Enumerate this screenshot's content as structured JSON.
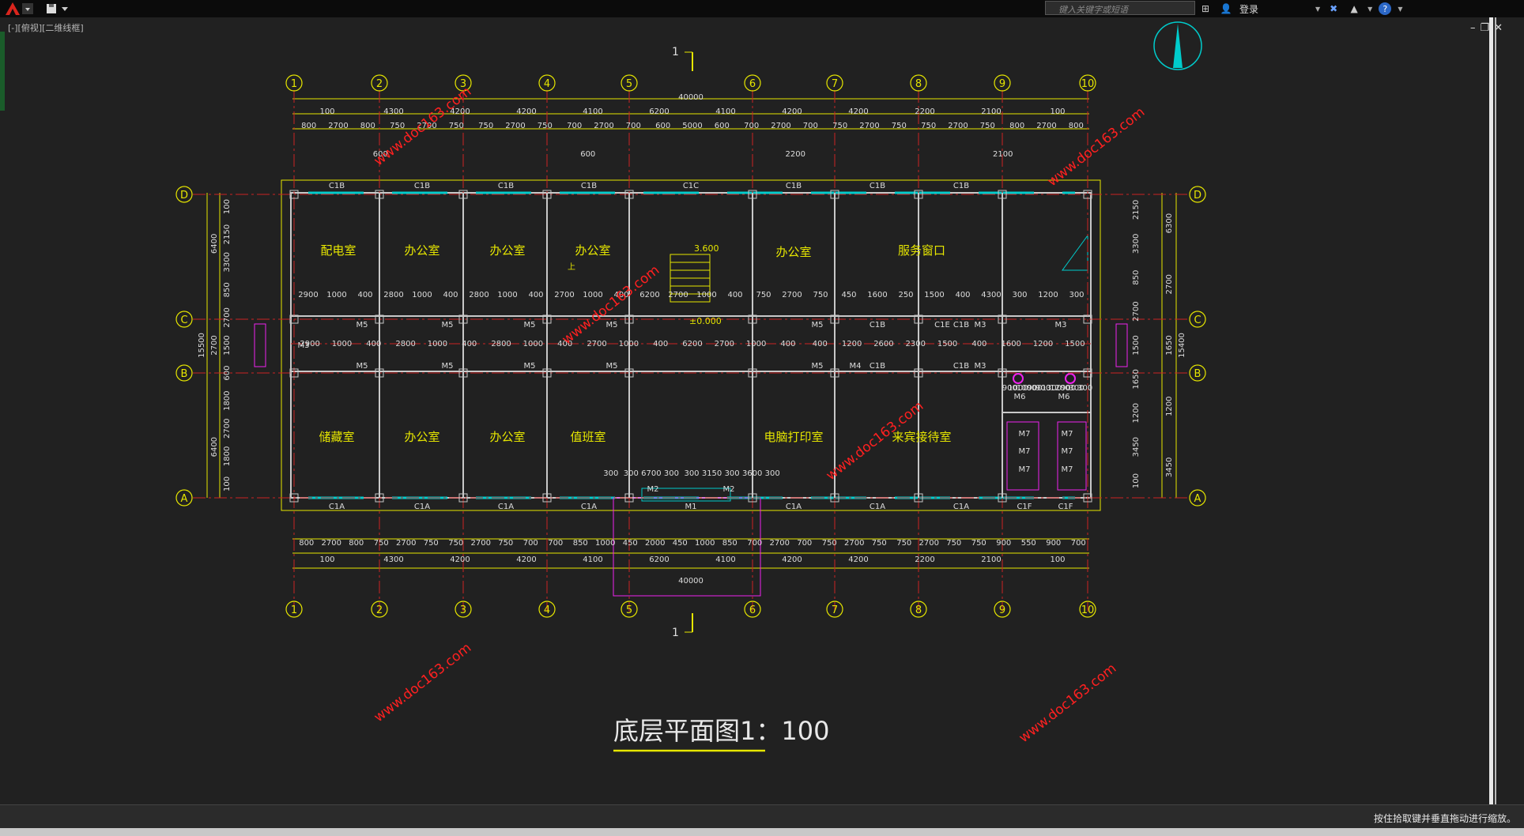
{
  "titlebar": {
    "search_placeholder": "键入关键字或短语",
    "login_label": "登录",
    "icons": [
      "autocad-logo-icon",
      "quick-access-icon",
      "binoculars-icon",
      "user-icon",
      "exchange-icon",
      "a360-icon",
      "help-icon"
    ]
  },
  "viewport": {
    "label": "[-][俯视][二维线框]"
  },
  "window_controls": {
    "minimize": "–",
    "restore": "❐",
    "close": "✕"
  },
  "status": {
    "message": "按住拾取键并垂直拖动进行缩放。"
  },
  "colors": {
    "background": "#212121",
    "axis": "#e6e600",
    "wall": "#c8c8c8",
    "window": "#00cccc",
    "column_line": "#cc2222",
    "fixture": "#ee22ee",
    "watermark": "#ff2020"
  },
  "drawing": {
    "title": "底层平面图1：100",
    "section_mark": "1",
    "axes_x": [
      "1",
      "2",
      "3",
      "4",
      "5",
      "6",
      "7",
      "8",
      "9",
      "10"
    ],
    "axes_y": [
      "D",
      "C",
      "B",
      "A"
    ],
    "total_width": "40000",
    "top_dims_row1": [
      "100",
      "4300",
      "4200",
      "4200",
      "4100",
      "6200",
      "4100",
      "4200",
      "4200",
      "2200",
      "2100",
      "100"
    ],
    "top_dims_row2": [
      "800",
      "2700",
      "800",
      "750",
      "2700",
      "750",
      "750",
      "2700",
      "750",
      "700",
      "2700",
      "700",
      "600",
      "5000",
      "600",
      "700",
      "2700",
      "700",
      "750",
      "2700",
      "750",
      "750",
      "2700",
      "750",
      "800",
      "2700",
      "800"
    ],
    "bottom_dims_row1": [
      "800",
      "2700",
      "800",
      "750",
      "2700",
      "750",
      "750",
      "2700",
      "750",
      "700",
      "700",
      "850",
      "1000",
      "450",
      "2000",
      "450",
      "1000",
      "850",
      "700",
      "2700",
      "700",
      "750",
      "2700",
      "750",
      "750",
      "2700",
      "750",
      "750",
      "900",
      "550",
      "900",
      "700"
    ],
    "bottom_dims_row2": [
      "100",
      "4300",
      "4200",
      "4200",
      "4100",
      "6200",
      "4100",
      "4200",
      "4200",
      "2200",
      "2100",
      "100"
    ],
    "left_dims_outer": [
      "6400",
      "2700",
      "6400"
    ],
    "left_dims_inner": [
      "100",
      "2150",
      "3300",
      "850",
      "2700",
      "1500",
      "600",
      "1800",
      "2700",
      "1800",
      "100"
    ],
    "left_total": "15500",
    "right_dims_inner": [
      "2150",
      "3300",
      "850",
      "2700",
      "1500",
      "1650",
      "1200",
      "3450",
      "100"
    ],
    "right_dims_outer": [
      "6300",
      "2700",
      "1650",
      "1200",
      "3450"
    ],
    "right_total": "15400",
    "top_extra": [
      "600",
      "600",
      "2200",
      "2100"
    ],
    "windows_top": [
      "C1B",
      "C1B",
      "C1B",
      "C1B",
      "C1C",
      "C1B",
      "C1B",
      "C1B"
    ],
    "windows_bottom": [
      "C1A",
      "C1A",
      "C1A",
      "C1A",
      "C1A",
      "C1A",
      "C1A",
      "C1F",
      "C1F"
    ],
    "rooms": [
      "配电室",
      "办公室",
      "办公室",
      "办公室",
      "办公室",
      "服务窗口",
      "储藏室",
      "办公室",
      "办公室",
      "值班室",
      "电脑打印室",
      "来宾接待室"
    ],
    "doors": [
      "M5",
      "M5",
      "M5",
      "M5",
      "M5",
      "M5",
      "M5",
      "M5",
      "M5",
      "M4",
      "M3",
      "M3",
      "M3",
      "M6",
      "M6",
      "M7",
      "M7",
      "M7",
      "M7",
      "M7",
      "M7",
      "M1",
      "M2",
      "M2",
      "M5",
      "M3"
    ],
    "corridor_dims_top": [
      "2900",
      "1000",
      "400",
      "2800",
      "1000",
      "400",
      "2800",
      "1000",
      "400",
      "2700",
      "1000",
      "400",
      "6200",
      "2700",
      "1000",
      "400",
      "750",
      "2700",
      "750",
      "450",
      "1600",
      "250",
      "1500",
      "400",
      "4300",
      "300",
      "1200",
      "300"
    ],
    "corridor_dims_bottom": [
      "2900",
      "1000",
      "400",
      "2800",
      "1000",
      "400",
      "2800",
      "1000",
      "400",
      "2700",
      "1000",
      "400",
      "6200",
      "2700",
      "1000",
      "400",
      "400",
      "1200",
      "2600",
      "2300",
      "1500",
      "400",
      "1600",
      "1200",
      "1500"
    ],
    "toilet_dims": [
      "900",
      "1000",
      "1000",
      "900",
      "900",
      "1300",
      "1200",
      "900",
      "300",
      "300"
    ],
    "entrance_dims": [
      "300",
      "300",
      "6700",
      "300",
      "300",
      "3150",
      "300",
      "3600",
      "300"
    ],
    "elevation_top": "3.600",
    "elevation_bottom": "±0.000",
    "misc_labels": [
      "C1E",
      "C1B",
      "C1B",
      "C1B",
      "C1B",
      "上"
    ],
    "watermark": "www.doc163.com"
  }
}
